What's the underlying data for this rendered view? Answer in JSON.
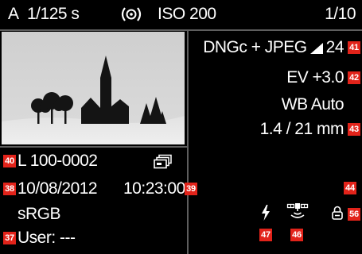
{
  "status_bar": {
    "mode": "A",
    "shutter_speed": "1/125 s",
    "metering_icon": "metering-icon",
    "iso": "ISO 200",
    "image_counter": "1/10"
  },
  "image_info": {
    "file_number": "L 100-0002",
    "multi_image_icon": "image-stack-icon",
    "date": "10/08/2012",
    "time": "10:23:00",
    "color_space": "sRGB",
    "user": "User: ---"
  },
  "capture_settings": {
    "file_format": "DNGc + JPEG",
    "resolution_icon": "resolution-icon",
    "resolution": "24",
    "exposure_compensation": "EV +3.0",
    "white_balance": "WB Auto",
    "lens": "1.4 / 21 mm"
  },
  "status_icons": {
    "flash": "flash-icon",
    "gps": "gps-icon",
    "lock": "lock-icon"
  },
  "callouts": {
    "n37": "37",
    "n38": "38",
    "n39": "39",
    "n40": "40",
    "n41": "41",
    "n42": "42",
    "n43": "43",
    "n44": "44",
    "n46": "46",
    "n47": "47",
    "n56": "56"
  },
  "colors": {
    "background": "#000000",
    "text": "#ffffff",
    "callout": "#e2231a",
    "divider": "#5e5e5e"
  }
}
